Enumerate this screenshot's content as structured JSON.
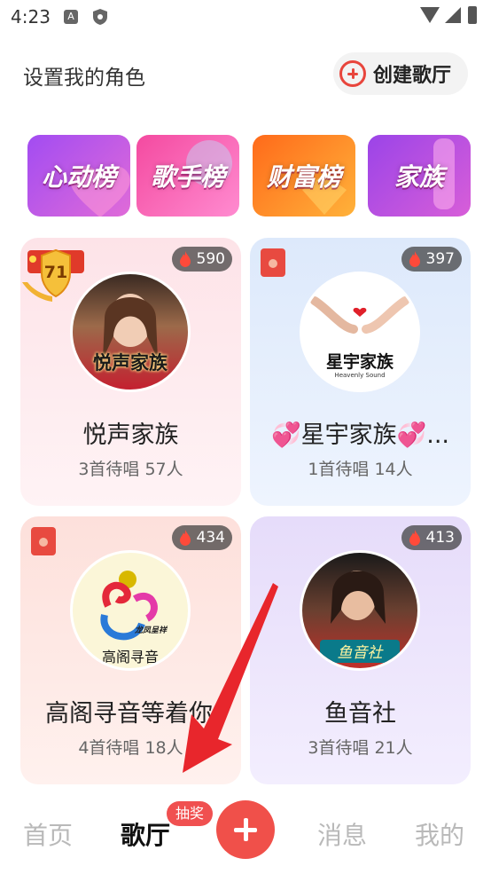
{
  "status_bar": {
    "time": "4:23"
  },
  "header": {
    "title": "设置我的角色",
    "create_button": "创建歌厅"
  },
  "categories": [
    {
      "label": "心动榜",
      "color_from": "#a24cf2",
      "color_to": "#e06bd8"
    },
    {
      "label": "歌手榜",
      "color_from": "#f44aa0",
      "color_to": "#ff8bd0"
    },
    {
      "label": "财富榜",
      "color_from": "#ff6a1a",
      "color_to": "#ffb23a"
    },
    {
      "label": "家族",
      "color_from": "#9b44e8",
      "color_to": "#d85ed8"
    }
  ],
  "rooms": [
    {
      "name": "悦声家族",
      "subtitle": "3首待唱 57人",
      "heat": "590",
      "avatar_caption": "悦声家族",
      "level_badge": "71",
      "has_red_packet": false,
      "bg_from": "#fde3e8",
      "bg_to": "#fff3f5"
    },
    {
      "name": "💞星宇家族💞...",
      "subtitle": "1首待唱 14人",
      "heat": "397",
      "avatar_caption": "星宇家族",
      "avatar_subcaption": "Heavenly Sound",
      "has_red_packet": true,
      "bg_from": "#dde9fb",
      "bg_to": "#eef4fe"
    },
    {
      "name": "高阁寻音等着你",
      "subtitle": "4首待唱 18人",
      "heat": "434",
      "avatar_caption": "高阁寻音",
      "avatar_tag": "龙凤呈祥",
      "has_red_packet": true,
      "bg_from": "#fde0db",
      "bg_to": "#fff1ee"
    },
    {
      "name": "鱼音社",
      "subtitle": "3首待唱 21人",
      "heat": "413",
      "avatar_caption": "鱼音社",
      "has_red_packet": false,
      "bg_from": "#e6dcfa",
      "bg_to": "#f3eefe"
    }
  ],
  "bottom_nav": {
    "home": "首页",
    "ktv": "歌厅",
    "badge": "抽奖",
    "messages": "消息",
    "mine": "我的"
  }
}
